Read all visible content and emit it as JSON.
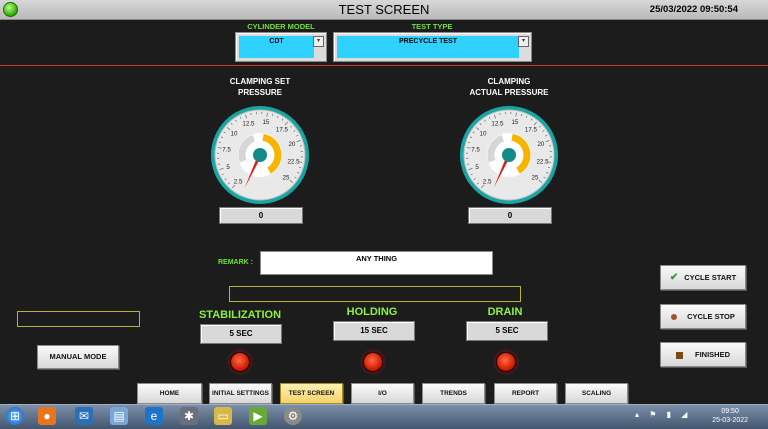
{
  "window": {
    "title": "TEST SCREEN",
    "datetime": "25/03/2022 09:50:54"
  },
  "selectors": {
    "cylinder_model_label": "CYLINDER MODEL",
    "cylinder_model_value": "CDT",
    "test_type_label": "TEST TYPE",
    "test_type_value": "PRECYCLE TEST"
  },
  "gauges": {
    "set": {
      "title_line1": "CLAMPING SET",
      "title_line2": "PRESSURE",
      "value": "0"
    },
    "actual": {
      "title_line1": "CLAMPING",
      "title_line2": "ACTUAL PRESSURE",
      "value": "0"
    },
    "scale_labels": [
      "2.5",
      "5",
      "7.5",
      "10",
      "12.5",
      "15",
      "17.5",
      "20",
      "22.5",
      "25"
    ]
  },
  "remark": {
    "label": "REMARK :",
    "value": "ANY THING"
  },
  "stages": [
    {
      "label": "STABILIZATION",
      "time": "5 SEC"
    },
    {
      "label": "HOLDING",
      "time": "15 SEC"
    },
    {
      "label": "DRAIN",
      "time": "5 SEC"
    }
  ],
  "controls": {
    "cycle_start": "CYCLE START",
    "cycle_stop": "CYCLE STOP",
    "finished": "FINISHED",
    "manual_mode": "MANUAL MODE"
  },
  "nav": [
    "HOME",
    "INITIAL SETTINGS",
    "TEST SCREEN",
    "I/O",
    "TRENDS",
    "REPORT",
    "SCALING"
  ],
  "nav_active": "TEST SCREEN",
  "taskbar": {
    "time": "09:50",
    "date": "25-03-2022"
  },
  "colors": {
    "accent_green": "#6fe03a",
    "select_blue": "#2fd1ff",
    "led_red": "#d32000",
    "gauge_rim": "#1aa5a5",
    "gauge_arc": "#f7b500"
  }
}
